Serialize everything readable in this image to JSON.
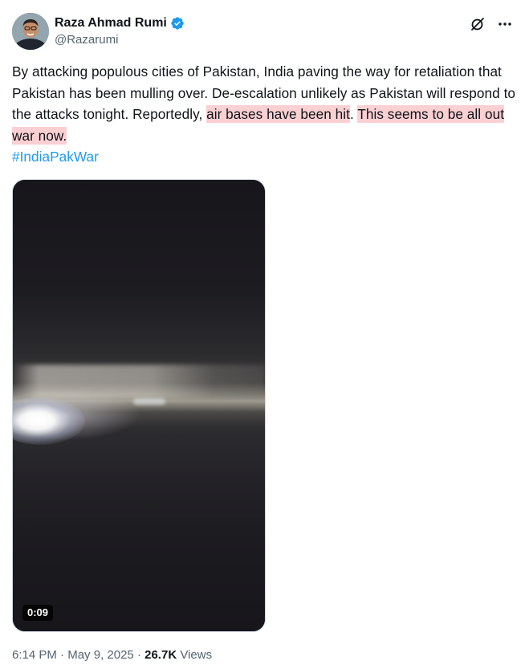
{
  "author": {
    "display_name": "Raza Ahmad Rumi",
    "handle": "@Razarumi",
    "verified": true,
    "avatar_icon": "profile-photo"
  },
  "header_actions": {
    "grok_icon": "grok-icon",
    "more_icon": "more-icon"
  },
  "tweet": {
    "text_part1": "By attacking populous cities of Pakistan, India paving the way for retaliation that Pakistan has been mulling over. De-escalation unlikely as Pakistan will respond to the attacks tonight. Reportedly,",
    "highlight1": "air bases have been hit",
    "text_part2": ".",
    "highlight2": "This seems to be all out war now.",
    "hashtag": "#IndiaPakWar",
    "highlight_color": "#fbd0d3"
  },
  "media": {
    "type": "video",
    "duration": "0:09"
  },
  "meta": {
    "time": "6:14 PM",
    "separator1": " · ",
    "date": "May 9, 2025",
    "separator2": " · ",
    "views_count": "26.7K",
    "views_label": "Views"
  },
  "colors": {
    "text": "#0f1419",
    "secondary": "#536471",
    "link": "#1d9bf0",
    "verified": "#1d9bf0"
  }
}
